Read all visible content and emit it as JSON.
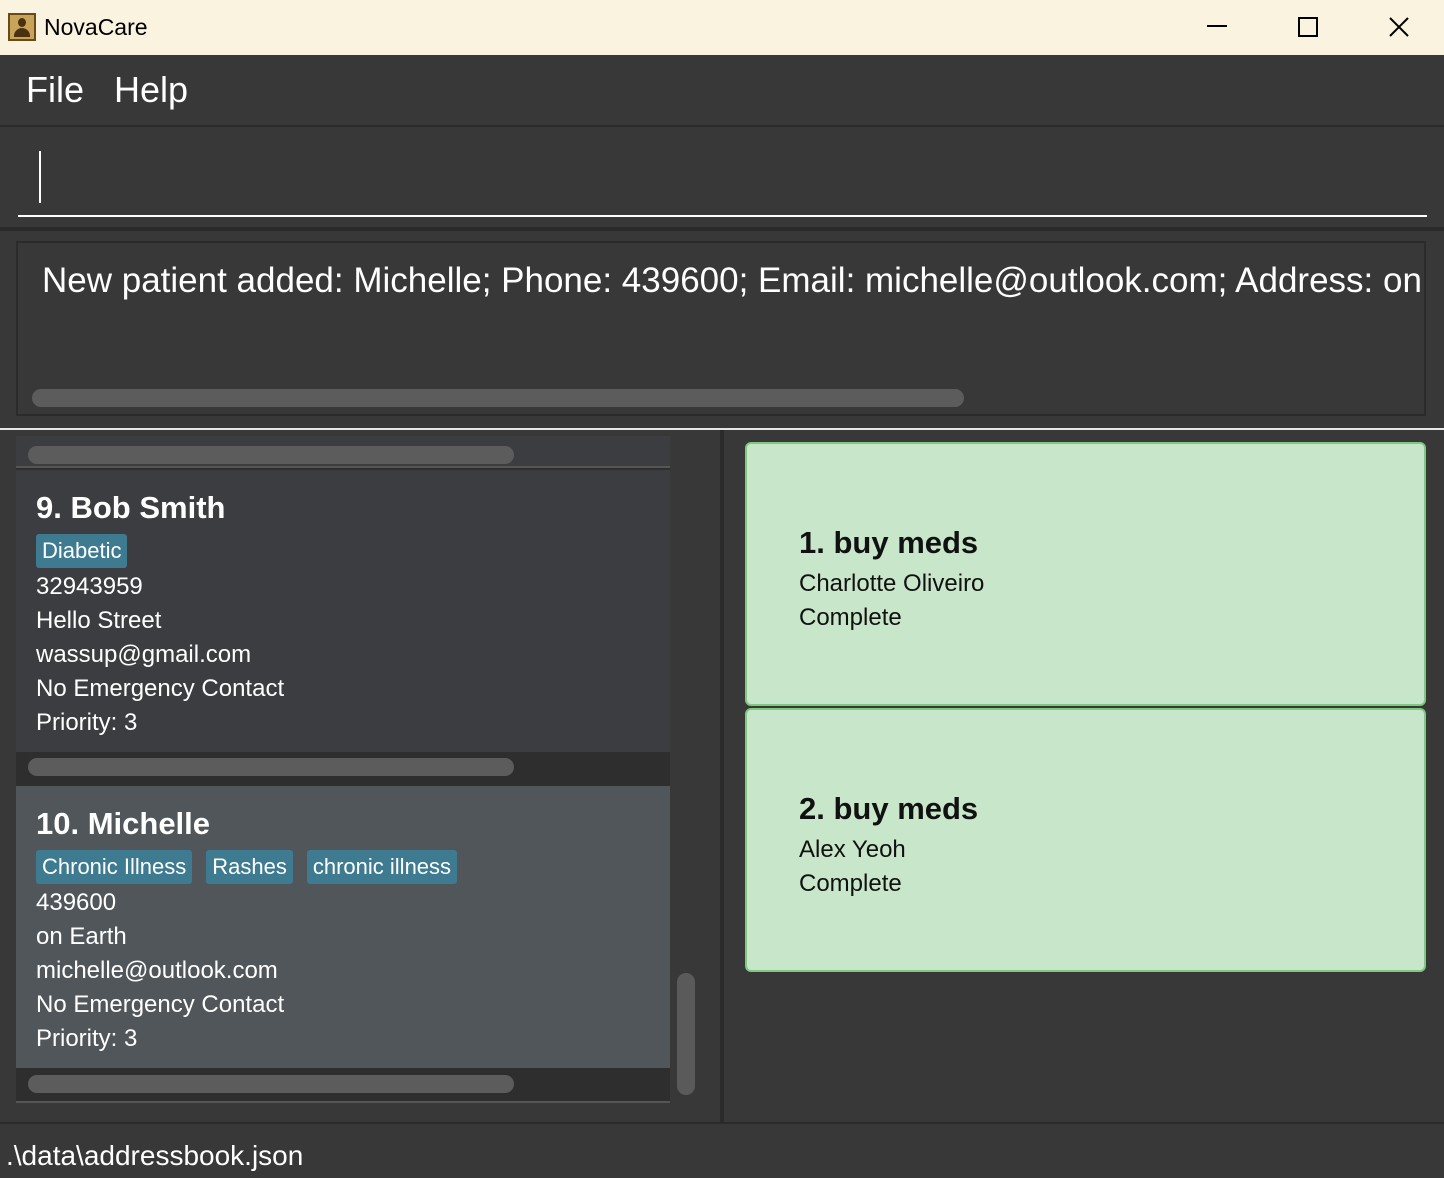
{
  "window": {
    "title": "NovaCare",
    "icon": "contact-book-icon"
  },
  "menu": {
    "file": "File",
    "help": "Help"
  },
  "command": {
    "value": ""
  },
  "result": {
    "text": "New patient added: Michelle; Phone: 439600; Email: michelle@outlook.com; Address: on Earth;"
  },
  "patients": [
    {
      "name": "9. Bob Smith",
      "tags": [
        "Diabetic"
      ],
      "phone": "32943959",
      "address": "Hello Street",
      "email": "wassup@gmail.com",
      "emergency": "No Emergency Contact",
      "priority": "Priority: 3"
    },
    {
      "name": "10. Michelle",
      "tags": [
        "Chronic Illness",
        "Rashes",
        "chronic illness"
      ],
      "phone": "439600",
      "address": "on Earth",
      "email": "michelle@outlook.com",
      "emergency": "No Emergency Contact",
      "priority": "Priority: 3"
    }
  ],
  "tasks": [
    {
      "title": "1. buy meds",
      "patient": "Charlotte Oliveiro",
      "status": "Complete"
    },
    {
      "title": "2. buy meds",
      "patient": "Alex Yeoh",
      "status": "Complete"
    }
  ],
  "status_bar": {
    "path": ".\\data\\addressbook.json"
  },
  "colors": {
    "tag": "#3e7b91",
    "task_bg": "#c8e6c9",
    "task_border": "#7fc880",
    "selected_card": "#50565a"
  }
}
